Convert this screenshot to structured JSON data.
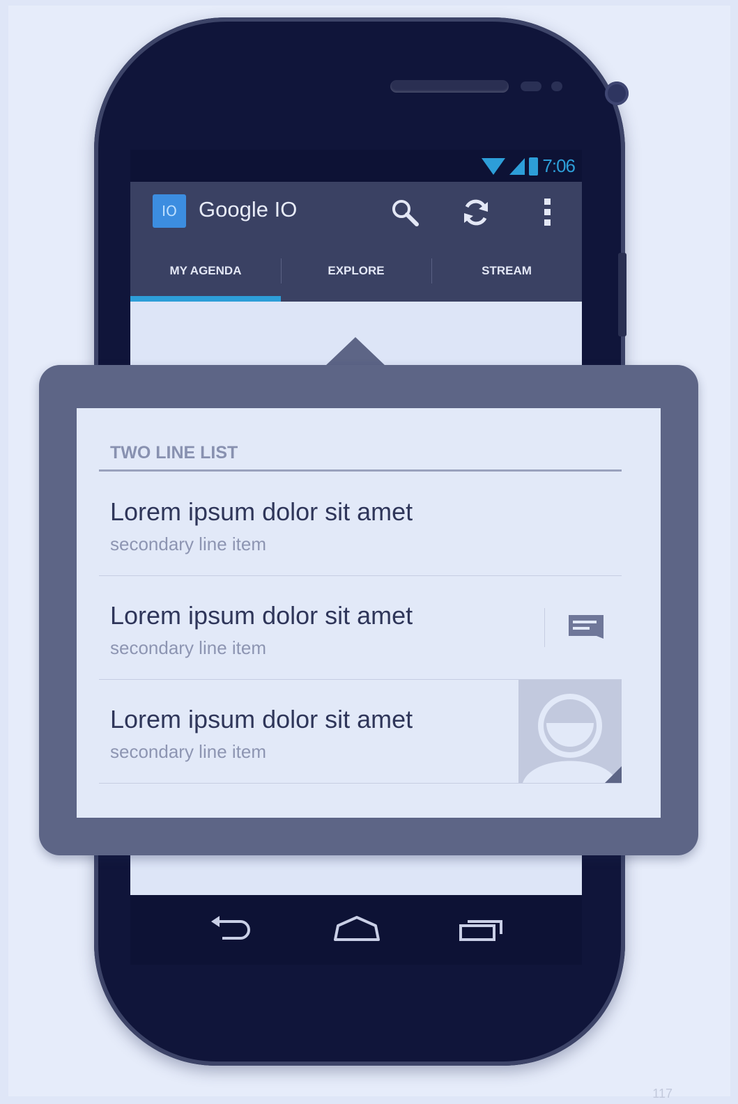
{
  "status_bar": {
    "time": "7:06"
  },
  "action_bar": {
    "app_icon_label": "IO",
    "title": "Google IO",
    "actions": [
      "search-icon",
      "refresh-icon",
      "overflow-menu-icon"
    ]
  },
  "tabs": [
    {
      "label": "MY AGENDA",
      "selected": true
    },
    {
      "label": "EXPLORE",
      "selected": false
    },
    {
      "label": "STREAM",
      "selected": false
    }
  ],
  "list": {
    "header": "TWO LINE LIST",
    "items": [
      {
        "primary": "Lorem ipsum dolor sit amet",
        "secondary": "secondary line item",
        "accessory": ""
      },
      {
        "primary": "Lorem ipsum dolor sit amet",
        "secondary": "secondary line item",
        "accessory": "message-icon"
      },
      {
        "primary": "Lorem ipsum dolor sit amet",
        "secondary": "secondary line item",
        "accessory": "contact-avatar"
      }
    ]
  },
  "nav_bar": {
    "buttons": [
      "back-icon",
      "home-icon",
      "recent-apps-icon"
    ]
  },
  "page_number": "117",
  "colors": {
    "accent": "#2d9ed8",
    "action_bar": "#3a4163",
    "callout": "#5d6586",
    "card": "#e2e9f8"
  }
}
